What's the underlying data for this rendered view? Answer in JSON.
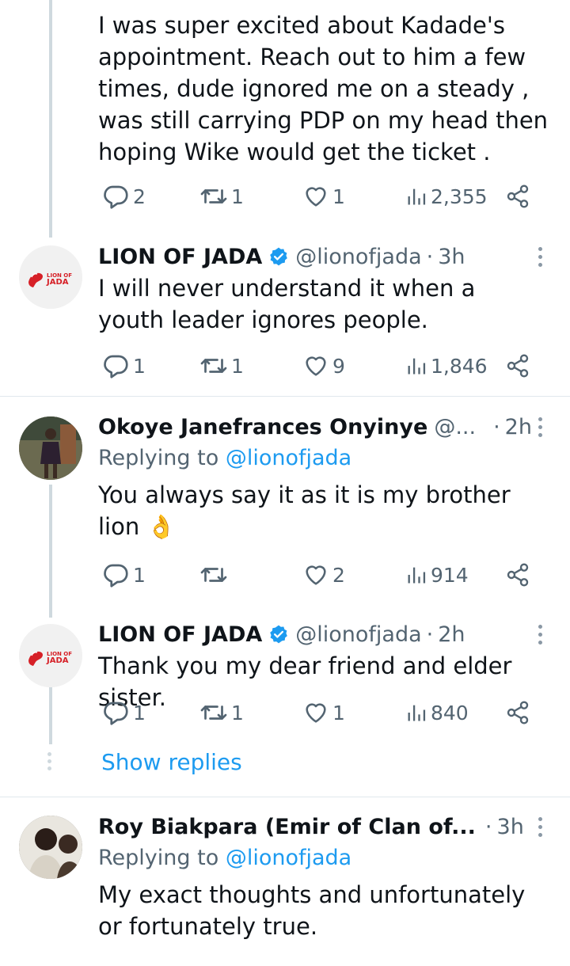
{
  "posts": [
    {
      "text": "I was super excited about Kadade's appointment. Reach out to him a few times, dude ignored me  on a steady , was still carrying PDP on my head then hoping Wike would get the ticket .",
      "replies": "2",
      "retweets": "1",
      "likes": "1",
      "views": "2,355"
    },
    {
      "name": "LION OF JADA",
      "handle": "@lionofjada",
      "time": "3h",
      "text": "I will never understand it when a youth leader ignores people.",
      "replies": "1",
      "retweets": "1",
      "likes": "9",
      "views": "1,846"
    },
    {
      "name": "Okoye Janefrances Onyinye",
      "handle": "@...",
      "time": "2h",
      "replying_label": "Replying to",
      "replying_to": "@lionofjada",
      "text": "You always say it as it is my brother lion",
      "emoji": "👌",
      "replies": "1",
      "retweets": "",
      "likes": "2",
      "views": "914"
    },
    {
      "name": "LION OF JADA",
      "handle": "@lionofjada",
      "time": "2h",
      "text": "Thank you my dear friend and elder sister.",
      "replies": "1",
      "retweets": "1",
      "likes": "1",
      "views": "840"
    },
    {
      "name": "Roy Biakpara (Emir of Clan of...",
      "time": "3h",
      "replying_label": "Replying to",
      "replying_to": "@lionofjada",
      "text": "My exact thoughts and unfortunately or fortunately true."
    }
  ],
  "show_replies": "Show replies",
  "avatar_logo": {
    "line1": "LION OF",
    "line2": "JADA"
  },
  "colors": {
    "accent": "#1d9bf0",
    "muted": "#536471",
    "logo_red": "#d62027"
  },
  "icons": [
    "reply-icon",
    "retweet-icon",
    "like-icon",
    "views-icon",
    "share-icon",
    "verified-icon",
    "more-icon"
  ]
}
